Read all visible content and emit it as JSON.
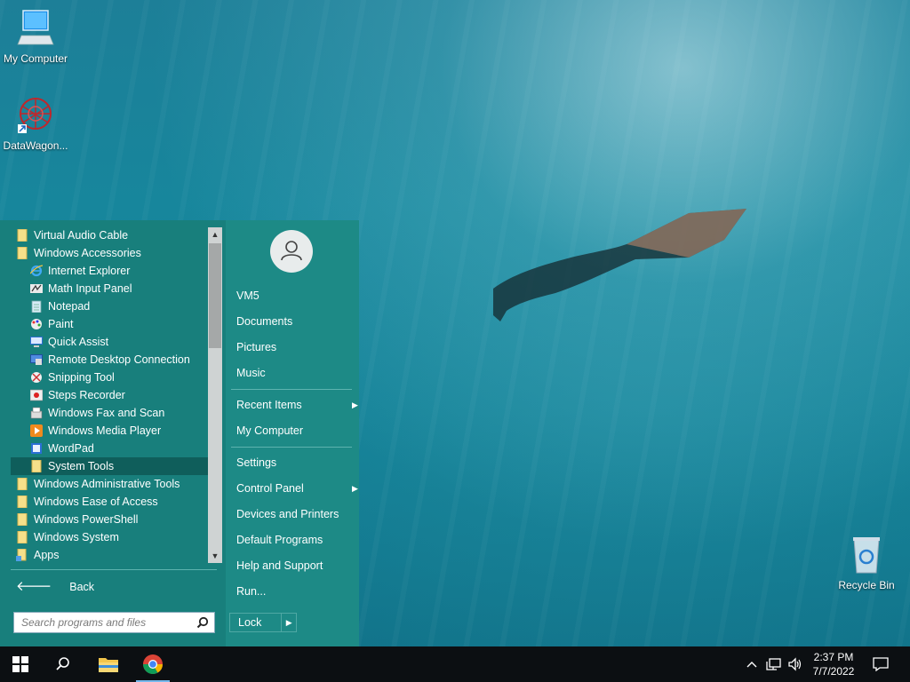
{
  "desktop": {
    "icons": [
      {
        "label": "My Computer",
        "icon": "computer-icon"
      },
      {
        "label": "DataWagon...",
        "icon": "datawagon-icon"
      },
      {
        "label": "Recycle Bin",
        "icon": "recycle-bin-icon"
      }
    ]
  },
  "start_menu": {
    "programs": [
      {
        "label": "Virtual Audio Cable",
        "icon": "folder-icon",
        "level": 0
      },
      {
        "label": "Windows Accessories",
        "icon": "folder-icon",
        "level": 0
      },
      {
        "label": "Internet Explorer",
        "icon": "internet-explorer-icon",
        "level": 1
      },
      {
        "label": "Math Input Panel",
        "icon": "math-input-icon",
        "level": 1
      },
      {
        "label": "Notepad",
        "icon": "notepad-icon",
        "level": 1
      },
      {
        "label": "Paint",
        "icon": "paint-icon",
        "level": 1
      },
      {
        "label": "Quick Assist",
        "icon": "quick-assist-icon",
        "level": 1
      },
      {
        "label": "Remote Desktop Connection",
        "icon": "remote-desktop-icon",
        "level": 1
      },
      {
        "label": "Snipping Tool",
        "icon": "snipping-tool-icon",
        "level": 1
      },
      {
        "label": "Steps Recorder",
        "icon": "steps-recorder-icon",
        "level": 1
      },
      {
        "label": "Windows Fax and Scan",
        "icon": "fax-scan-icon",
        "level": 1
      },
      {
        "label": "Windows Media Player",
        "icon": "media-player-icon",
        "level": 1
      },
      {
        "label": "WordPad",
        "icon": "wordpad-icon",
        "level": 1
      },
      {
        "label": "System Tools",
        "icon": "folder-icon",
        "level": 1,
        "selected": true
      },
      {
        "label": "Windows Administrative Tools",
        "icon": "folder-icon",
        "level": 0
      },
      {
        "label": "Windows Ease of Access",
        "icon": "folder-icon",
        "level": 0
      },
      {
        "label": "Windows PowerShell",
        "icon": "folder-icon",
        "level": 0
      },
      {
        "label": "Windows System",
        "icon": "folder-icon",
        "level": 0
      },
      {
        "label": "Apps",
        "icon": "apps-icon",
        "level": 0
      }
    ],
    "back_label": "Back",
    "search_placeholder": "Search programs and files",
    "user": "VM5",
    "right_links": {
      "documents": "Documents",
      "pictures": "Pictures",
      "music": "Music",
      "recent_items": "Recent Items",
      "my_computer": "My Computer",
      "settings": "Settings",
      "control_panel": "Control Panel",
      "devices_printers": "Devices and Printers",
      "default_programs": "Default Programs",
      "help_support": "Help and Support",
      "run": "Run..."
    },
    "lock_label": "Lock"
  },
  "taskbar": {
    "time": "2:37 PM",
    "date": "7/7/2022"
  },
  "colors": {
    "menu_bg": "#1d8a86",
    "programs_bg": "#187f7c",
    "taskbar_bg": "#0c0f12"
  }
}
